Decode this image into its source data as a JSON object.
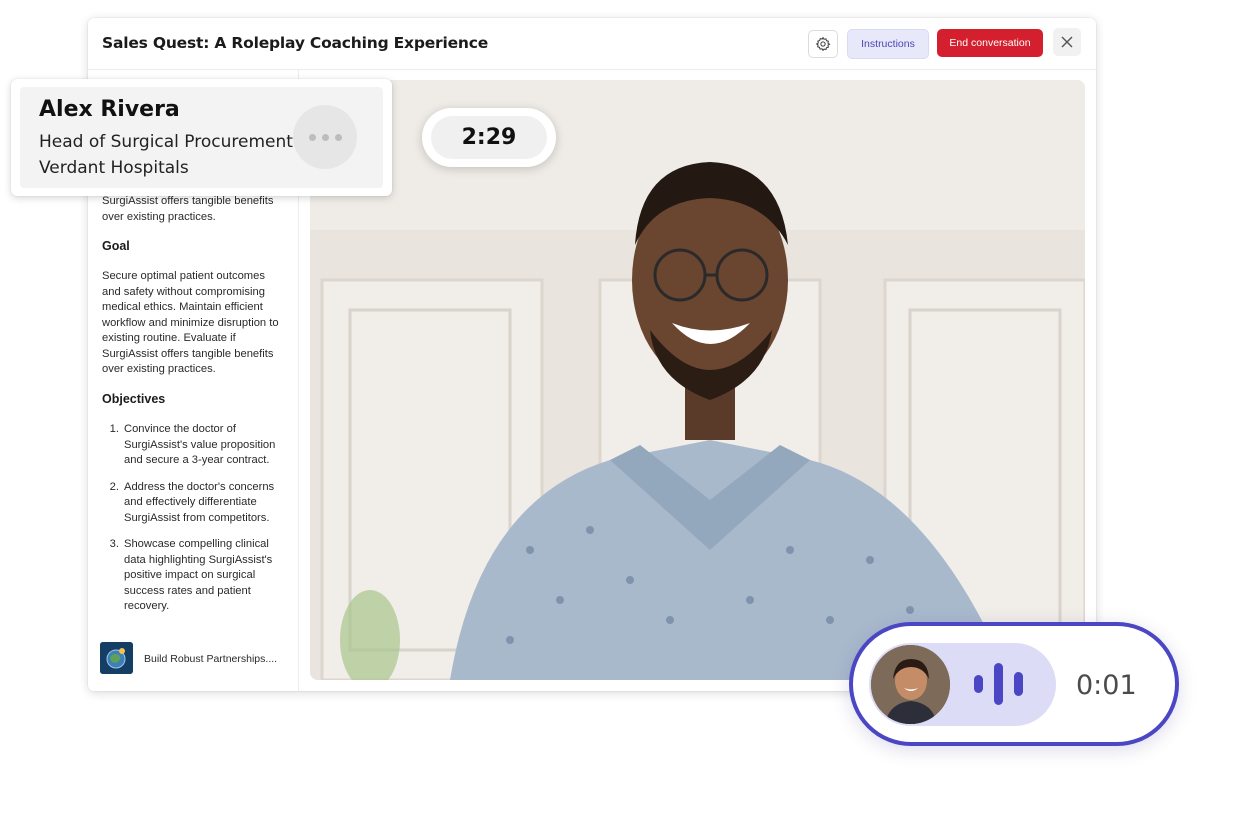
{
  "header": {
    "title": "Sales Quest: A Roleplay Coaching Experience",
    "settings_icon": "gear-icon",
    "instructions_label": "Instructions",
    "end_label": "End conversation",
    "close_icon": "close-icon"
  },
  "colors": {
    "accent": "#4a46c4",
    "danger": "#d41f2e",
    "instructions_bg": "#e8e8fb"
  },
  "persona": {
    "name": "Alex Rivera",
    "role": "Head of Surgical Procurement",
    "organization": "Verdant Hospitals"
  },
  "timer": {
    "value": "2:29"
  },
  "sidebar": {
    "intro_tail": "SurgiAssist offers tangible benefits over existing practices.",
    "goal_heading": "Goal",
    "goal_text": "Secure optimal patient outcomes and safety without compromising medical ethics. Maintain efficient workflow and minimize disruption to existing routine. Evaluate if SurgiAssist offers tangible benefits over existing practices.",
    "objectives_heading": "Objectives",
    "objectives": [
      {
        "num": "1.",
        "text": "Convince the doctor of SurgiAssist's value proposition and secure a 3-year contract."
      },
      {
        "num": "2.",
        "text": "Address the doctor's concerns and effectively differentiate SurgiAssist from competitors."
      },
      {
        "num": "3.",
        "text": "Showcase compelling clinical data highlighting SurgiAssist's positive impact on surgical success rates and patient recovery."
      }
    ],
    "module_title": "Build Robust Partnerships...."
  },
  "recorder": {
    "time": "0:01",
    "icon": "audio-wave-icon"
  }
}
